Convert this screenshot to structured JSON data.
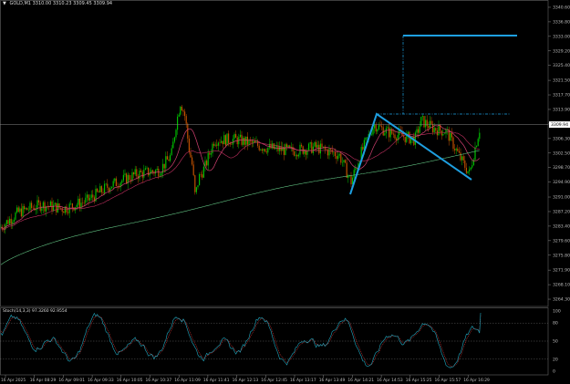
{
  "header": {
    "symbol_tf": "GOLD,M1",
    "ohlc": "3310.00 3310.23 3309.45 3309.94"
  },
  "stochastic": {
    "title": "Stoch(14,3,3) 97.3260 92.9554",
    "levels": [
      "100",
      "80",
      "50",
      "20",
      "0"
    ]
  },
  "price_axis": {
    "ticks": [
      "3340.60",
      "3336.80",
      "3333.00",
      "3329.20",
      "3325.40",
      "3321.50",
      "3317.70",
      "3313.90",
      "3310.10",
      "3306.30",
      "3302.50",
      "3298.70",
      "3294.90",
      "3291.00",
      "3287.20",
      "3283.40",
      "3279.60",
      "3275.80",
      "3271.90",
      "3268.10",
      "3264.30"
    ],
    "current_price": "3309.94"
  },
  "time_axis": {
    "ticks": [
      "16 Apr 2025",
      "16 Apr 08:29",
      "16 Apr 09:01",
      "16 Apr 09:33",
      "16 Apr 10:05",
      "16 Apr 10:37",
      "16 Apr 11:09",
      "16 Apr 11:41",
      "16 Apr 12:13",
      "16 Apr 12:45",
      "16 Apr 13:17",
      "16 Apr 13:49",
      "16 Apr 14:21",
      "16 Apr 14:53",
      "16 Apr 15:25",
      "16 Apr 15:57",
      "16 Apr 16:29"
    ]
  },
  "colors": {
    "background": "#000000",
    "bull": "#00c000",
    "bear": "#c05000",
    "ma_fast": "#d04070",
    "ma_slow": "#60c080",
    "drawing": "#1e9fe0",
    "stoch_main": "#20a8c0",
    "stoch_signal": "#ff4040",
    "price_line": "#888888",
    "axis_text": "#bbbbbb"
  }
}
